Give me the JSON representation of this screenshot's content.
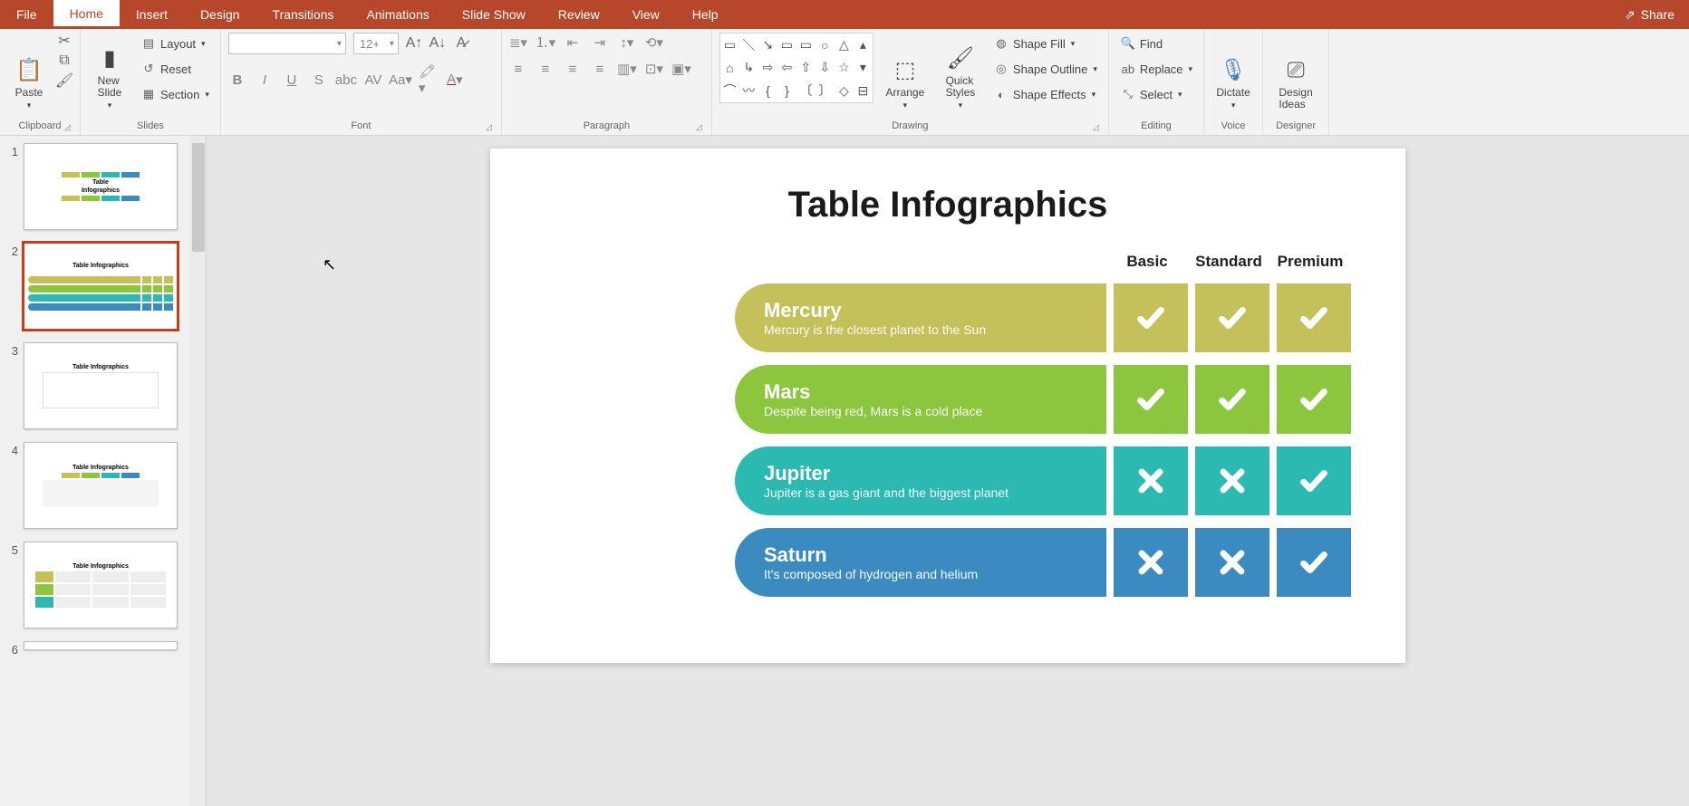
{
  "tabs": {
    "file": "File",
    "home": "Home",
    "insert": "Insert",
    "design": "Design",
    "transitions": "Transitions",
    "animations": "Animations",
    "slideshow": "Slide Show",
    "review": "Review",
    "view": "View",
    "help": "Help"
  },
  "share": "Share",
  "ribbon": {
    "clipboard": {
      "paste": "Paste",
      "label": "Clipboard"
    },
    "slides": {
      "new_slide": "New\nSlide",
      "layout": "Layout",
      "reset": "Reset",
      "section": "Section",
      "label": "Slides"
    },
    "font": {
      "size": "12+",
      "label": "Font"
    },
    "paragraph": {
      "label": "Paragraph"
    },
    "drawing": {
      "arrange": "Arrange",
      "quick_styles": "Quick\nStyles",
      "shape_fill": "Shape Fill",
      "shape_outline": "Shape Outline",
      "shape_effects": "Shape Effects",
      "label": "Drawing"
    },
    "editing": {
      "find": "Find",
      "replace": "Replace",
      "select": "Select",
      "label": "Editing"
    },
    "voice": {
      "dictate": "Dictate",
      "label": "Voice"
    },
    "designer": {
      "design_ideas": "Design\nIdeas",
      "label": "Designer"
    }
  },
  "thumbs": [
    "1",
    "2",
    "3",
    "4",
    "5",
    "6"
  ],
  "thumb_titles": {
    "t1a": "Table",
    "t1b": "Infographics",
    "t2": "Table Infographics",
    "t3": "Table Infographics",
    "t4": "Table Infographics",
    "t5": "Table Infographics"
  },
  "slide": {
    "title": "Table Infographics",
    "columns": [
      "Basic",
      "Standard",
      "Premium"
    ],
    "rows": [
      {
        "name": "Mercury",
        "desc": "Mercury is the closest planet to the Sun",
        "color": "c-olive",
        "cells": [
          "check",
          "check",
          "check"
        ]
      },
      {
        "name": "Mars",
        "desc": "Despite being red, Mars is a cold place",
        "color": "c-green",
        "cells": [
          "check",
          "check",
          "check"
        ]
      },
      {
        "name": "Jupiter",
        "desc": "Jupiter is a gas giant and the biggest planet",
        "color": "c-teal",
        "cells": [
          "cross",
          "cross",
          "check"
        ]
      },
      {
        "name": "Saturn",
        "desc": "It's composed of hydrogen and helium",
        "color": "c-blue",
        "cells": [
          "cross",
          "cross",
          "check"
        ]
      }
    ]
  }
}
